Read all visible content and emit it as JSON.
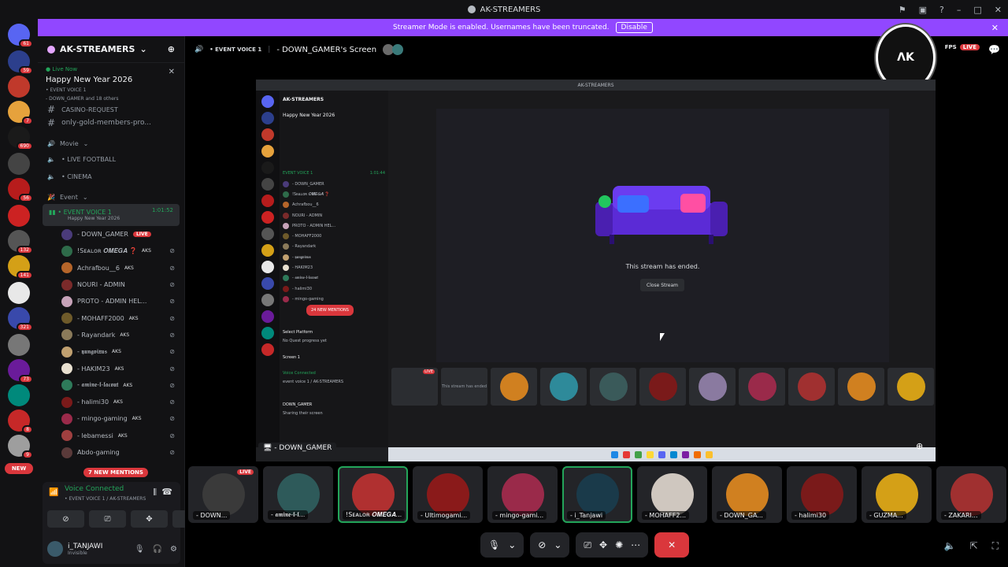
{
  "window": {
    "title": "AK-STREAMERS"
  },
  "banner": {
    "text": "Streamer Mode is enabled. Usernames have been truncated.",
    "disable_label": "Disable"
  },
  "servers": [
    {
      "badge": "61",
      "color": "#5865f2"
    },
    {
      "badge": "59",
      "color": "#2c3f8c"
    },
    {
      "badge": "",
      "color": "#c0392b"
    },
    {
      "badge": "7",
      "color": "#e6a23c"
    },
    {
      "badge": "690",
      "color": "#1a1a1a"
    },
    {
      "badge": "",
      "color": "#444"
    },
    {
      "badge": "56",
      "color": "#b71c1c"
    },
    {
      "badge": "",
      "color": "#cc2222"
    },
    {
      "badge": "132",
      "color": "#555"
    },
    {
      "badge": "141",
      "color": "#d4a017"
    },
    {
      "badge": "",
      "color": "#e8e8e8"
    },
    {
      "badge": "321",
      "color": "#3949ab"
    },
    {
      "badge": "",
      "color": "#777"
    },
    {
      "badge": "73",
      "color": "#6a1b9a"
    },
    {
      "badge": "",
      "color": "#00897b"
    },
    {
      "badge": "8",
      "color": "#c62828"
    },
    {
      "badge": "9",
      "color": "#9e9e9e"
    }
  ],
  "new_label": "NEW",
  "sidebar": {
    "server_name": "AK-STREAMERS",
    "live_now": "Live Now",
    "event_title": "Happy New Year 2026",
    "event_channel": "• EVENT VOICE 1",
    "event_people": "- DOWN_GAMER and 18 others",
    "cut_channel": "CASINO-REQUEST",
    "channel_gold": "only-gold-members-pro...",
    "cat_movie": "Movie",
    "ch_football": "• LIVE FOOTBALL",
    "ch_cinema": "• CINEMA",
    "cat_event": "Event",
    "active_channel": "• EVENT VOICE 1",
    "active_desc": "Happy New Year 2026",
    "active_timer": "1:01:52",
    "members": [
      {
        "name": "- DOWN_GAMER",
        "tag": "",
        "live": "LIVE",
        "color": "#4a3b7a"
      },
      {
        "name": "!Sᴇᴀʟᴏʀ 𝑶𝑴𝑬𝑮𝑨 ❓",
        "tag": "AKS",
        "live": "",
        "color": "#2e6b4a"
      },
      {
        "name": "Achrafbou__6",
        "tag": "AKS",
        "live": "",
        "color": "#b5652a"
      },
      {
        "name": "NOURI - ADMIN",
        "tag": "",
        "live": "",
        "color": "#7a2a2a"
      },
      {
        "name": "PROTO - ADMIN HEL...",
        "tag": "",
        "live": "",
        "color": "#c7a3b9"
      },
      {
        "name": "- MOHAFF2000",
        "tag": "AKS",
        "live": "",
        "color": "#6e5a2a"
      },
      {
        "name": "- Rayandark",
        "tag": "AKS",
        "live": "",
        "color": "#8a7a5a"
      },
      {
        "name": "- 𝖞𝖚𝖓𝖌𝖛𝖎𝖝𝖚𝖘",
        "tag": "AKS",
        "live": "",
        "color": "#c0a070"
      },
      {
        "name": "- HAKIM23",
        "tag": "AKS",
        "live": "",
        "color": "#e8e0d0"
      },
      {
        "name": "- 𝖆𝖒𝖎𝖓𝖊-𝖑-𝖑𝖆𝖈𝖔𝖚𝖙",
        "tag": "AKS",
        "live": "",
        "color": "#2e7a5a"
      },
      {
        "name": "- halimi30",
        "tag": "AKS",
        "live": "",
        "color": "#7a1a1a"
      },
      {
        "name": "- mingo-gaming",
        "tag": "AKS",
        "live": "",
        "color": "#9a2a4a"
      },
      {
        "name": "- lebamessi",
        "tag": "AKS",
        "live": "",
        "color": "#a04040"
      },
      {
        "name": "Abdo-gaming",
        "tag": "",
        "live": "",
        "color": "#5a3a3a"
      }
    ],
    "mentions": "7 NEW MENTIONS",
    "voice_connected": "Voice Connected",
    "voice_sub": "• EVENT VOICE 1 / AK-STREAMERS",
    "username": "i_TANJAWI",
    "status": "Invisible"
  },
  "main": {
    "channel": "• EVENT VOICE 1",
    "screen_title": "- DOWN_GAMER's Screen",
    "fps": "FPS",
    "live": "LIVE",
    "stream_label": "- DOWN_GAMER",
    "inner": {
      "title": "AK-STREAMERS",
      "event_title": "Happy New Year 2026",
      "active_channel": "EVENT VOICE 1",
      "timer": "1:01:44",
      "mentions": "24 NEW MENTIONS",
      "select_platform": "Select Platform",
      "no_quest": "No Quest progress yet",
      "screen1": "Screen 1",
      "voice_connected": "Voice Connected",
      "voice_sub": "event voice 1 / AK-STREAMERS",
      "user": "DOWN_GAMER",
      "user_status": "Sharing their screen",
      "ended": "This stream has ended.",
      "close_stream": "Close Stream",
      "tile_live": "LIVE",
      "tile_ended": "This stream has ended"
    },
    "tiles": [
      {
        "name": "- DOWN...",
        "live": "LIVE",
        "color": "#3a3a3a",
        "speaking": false
      },
      {
        "name": "- 𝖆𝖒𝖎𝖓𝖊-𝖑-𝖑...",
        "live": "",
        "color": "#2e5a5a",
        "speaking": false
      },
      {
        "name": "!Sᴇᴀʟᴏʀ 𝑶𝑴𝑬𝑮𝑨...",
        "live": "",
        "color": "#b03030",
        "speaking": true
      },
      {
        "name": "- Ultimogami...",
        "live": "",
        "color": "#8a1a1a",
        "speaking": false
      },
      {
        "name": "- mingo-gami...",
        "live": "",
        "color": "#9a2a4a",
        "speaking": false
      },
      {
        "name": "- i_Tanjawi",
        "live": "",
        "color": "#1a3a4a",
        "speaking": true
      },
      {
        "name": "- MOHAFF2...",
        "live": "",
        "color": "#cfc7bf",
        "speaking": false
      },
      {
        "name": "- DOWN_GA...",
        "live": "",
        "color": "#d08020",
        "speaking": false
      },
      {
        "name": "- halimi30",
        "live": "",
        "color": "#7a1a1a",
        "speaking": false
      },
      {
        "name": "- GUZMA...",
        "live": "",
        "color": "#d4a017",
        "speaking": false
      },
      {
        "name": "- ZAKARI...",
        "live": "",
        "color": "#a03030",
        "speaking": false
      }
    ]
  },
  "accent": "#9147ff",
  "live_color": "#da373c",
  "voice_color": "#23a55a"
}
